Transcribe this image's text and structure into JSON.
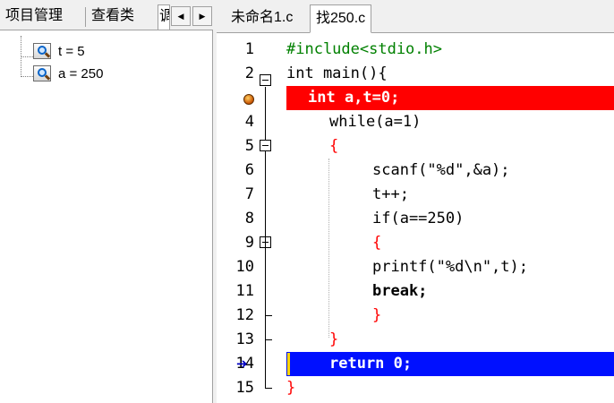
{
  "left_panel": {
    "tabs": [
      "项目管理",
      "查看类",
      "调"
    ],
    "scroll_left": "◀",
    "scroll_right": "▶",
    "watches": [
      {
        "label": "t = 5"
      },
      {
        "label": "a = 250"
      }
    ]
  },
  "editor": {
    "tabs": [
      "未命名1.c",
      "找250.c"
    ],
    "active_tab": "找250.c",
    "lines": [
      {
        "n": "1",
        "text": "#include<stdio.h>"
      },
      {
        "n": "2",
        "text": "int main(){"
      },
      {
        "n": "3",
        "text": "int a,t=0;"
      },
      {
        "n": "4",
        "text": "while(a=1)"
      },
      {
        "n": "5",
        "text": "{"
      },
      {
        "n": "6",
        "text": "scanf(\"%d\",&a);"
      },
      {
        "n": "7",
        "text": "t++;"
      },
      {
        "n": "8",
        "text": "if(a==250)"
      },
      {
        "n": "9",
        "text": "{"
      },
      {
        "n": "10",
        "text": "printf(\"%d\\n\",t);"
      },
      {
        "n": "11",
        "text": "break;"
      },
      {
        "n": "12",
        "text": "}"
      },
      {
        "n": "13",
        "text": "}"
      },
      {
        "n": "14",
        "text": "return 0;"
      },
      {
        "n": "15",
        "text": "}"
      }
    ],
    "breakpoint_line": "3",
    "current_line": "14"
  }
}
